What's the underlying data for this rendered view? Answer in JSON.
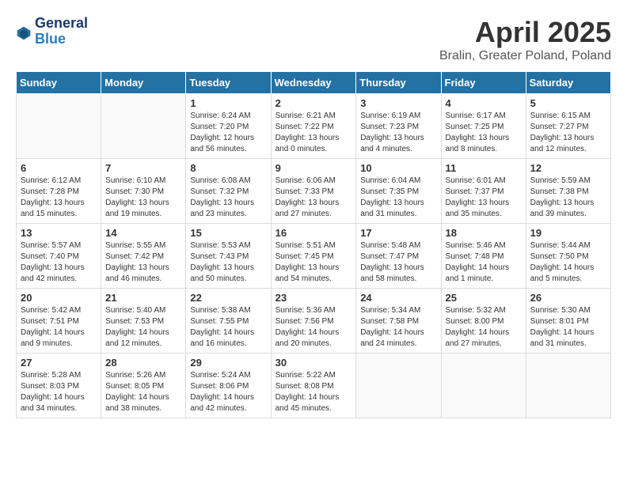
{
  "header": {
    "logo_line1": "General",
    "logo_line2": "Blue",
    "title": "April 2025",
    "subtitle": "Bralin, Greater Poland, Poland"
  },
  "weekdays": [
    "Sunday",
    "Monday",
    "Tuesday",
    "Wednesday",
    "Thursday",
    "Friday",
    "Saturday"
  ],
  "weeks": [
    [
      {
        "day": "",
        "content": ""
      },
      {
        "day": "",
        "content": ""
      },
      {
        "day": "1",
        "content": "Sunrise: 6:24 AM\nSunset: 7:20 PM\nDaylight: 12 hours and 56 minutes."
      },
      {
        "day": "2",
        "content": "Sunrise: 6:21 AM\nSunset: 7:22 PM\nDaylight: 13 hours and 0 minutes."
      },
      {
        "day": "3",
        "content": "Sunrise: 6:19 AM\nSunset: 7:23 PM\nDaylight: 13 hours and 4 minutes."
      },
      {
        "day": "4",
        "content": "Sunrise: 6:17 AM\nSunset: 7:25 PM\nDaylight: 13 hours and 8 minutes."
      },
      {
        "day": "5",
        "content": "Sunrise: 6:15 AM\nSunset: 7:27 PM\nDaylight: 13 hours and 12 minutes."
      }
    ],
    [
      {
        "day": "6",
        "content": "Sunrise: 6:12 AM\nSunset: 7:28 PM\nDaylight: 13 hours and 15 minutes."
      },
      {
        "day": "7",
        "content": "Sunrise: 6:10 AM\nSunset: 7:30 PM\nDaylight: 13 hours and 19 minutes."
      },
      {
        "day": "8",
        "content": "Sunrise: 6:08 AM\nSunset: 7:32 PM\nDaylight: 13 hours and 23 minutes."
      },
      {
        "day": "9",
        "content": "Sunrise: 6:06 AM\nSunset: 7:33 PM\nDaylight: 13 hours and 27 minutes."
      },
      {
        "day": "10",
        "content": "Sunrise: 6:04 AM\nSunset: 7:35 PM\nDaylight: 13 hours and 31 minutes."
      },
      {
        "day": "11",
        "content": "Sunrise: 6:01 AM\nSunset: 7:37 PM\nDaylight: 13 hours and 35 minutes."
      },
      {
        "day": "12",
        "content": "Sunrise: 5:59 AM\nSunset: 7:38 PM\nDaylight: 13 hours and 39 minutes."
      }
    ],
    [
      {
        "day": "13",
        "content": "Sunrise: 5:57 AM\nSunset: 7:40 PM\nDaylight: 13 hours and 42 minutes."
      },
      {
        "day": "14",
        "content": "Sunrise: 5:55 AM\nSunset: 7:42 PM\nDaylight: 13 hours and 46 minutes."
      },
      {
        "day": "15",
        "content": "Sunrise: 5:53 AM\nSunset: 7:43 PM\nDaylight: 13 hours and 50 minutes."
      },
      {
        "day": "16",
        "content": "Sunrise: 5:51 AM\nSunset: 7:45 PM\nDaylight: 13 hours and 54 minutes."
      },
      {
        "day": "17",
        "content": "Sunrise: 5:48 AM\nSunset: 7:47 PM\nDaylight: 13 hours and 58 minutes."
      },
      {
        "day": "18",
        "content": "Sunrise: 5:46 AM\nSunset: 7:48 PM\nDaylight: 14 hours and 1 minute."
      },
      {
        "day": "19",
        "content": "Sunrise: 5:44 AM\nSunset: 7:50 PM\nDaylight: 14 hours and 5 minutes."
      }
    ],
    [
      {
        "day": "20",
        "content": "Sunrise: 5:42 AM\nSunset: 7:51 PM\nDaylight: 14 hours and 9 minutes."
      },
      {
        "day": "21",
        "content": "Sunrise: 5:40 AM\nSunset: 7:53 PM\nDaylight: 14 hours and 12 minutes."
      },
      {
        "day": "22",
        "content": "Sunrise: 5:38 AM\nSunset: 7:55 PM\nDaylight: 14 hours and 16 minutes."
      },
      {
        "day": "23",
        "content": "Sunrise: 5:36 AM\nSunset: 7:56 PM\nDaylight: 14 hours and 20 minutes."
      },
      {
        "day": "24",
        "content": "Sunrise: 5:34 AM\nSunset: 7:58 PM\nDaylight: 14 hours and 24 minutes."
      },
      {
        "day": "25",
        "content": "Sunrise: 5:32 AM\nSunset: 8:00 PM\nDaylight: 14 hours and 27 minutes."
      },
      {
        "day": "26",
        "content": "Sunrise: 5:30 AM\nSunset: 8:01 PM\nDaylight: 14 hours and 31 minutes."
      }
    ],
    [
      {
        "day": "27",
        "content": "Sunrise: 5:28 AM\nSunset: 8:03 PM\nDaylight: 14 hours and 34 minutes."
      },
      {
        "day": "28",
        "content": "Sunrise: 5:26 AM\nSunset: 8:05 PM\nDaylight: 14 hours and 38 minutes."
      },
      {
        "day": "29",
        "content": "Sunrise: 5:24 AM\nSunset: 8:06 PM\nDaylight: 14 hours and 42 minutes."
      },
      {
        "day": "30",
        "content": "Sunrise: 5:22 AM\nSunset: 8:08 PM\nDaylight: 14 hours and 45 minutes."
      },
      {
        "day": "",
        "content": ""
      },
      {
        "day": "",
        "content": ""
      },
      {
        "day": "",
        "content": ""
      }
    ]
  ]
}
